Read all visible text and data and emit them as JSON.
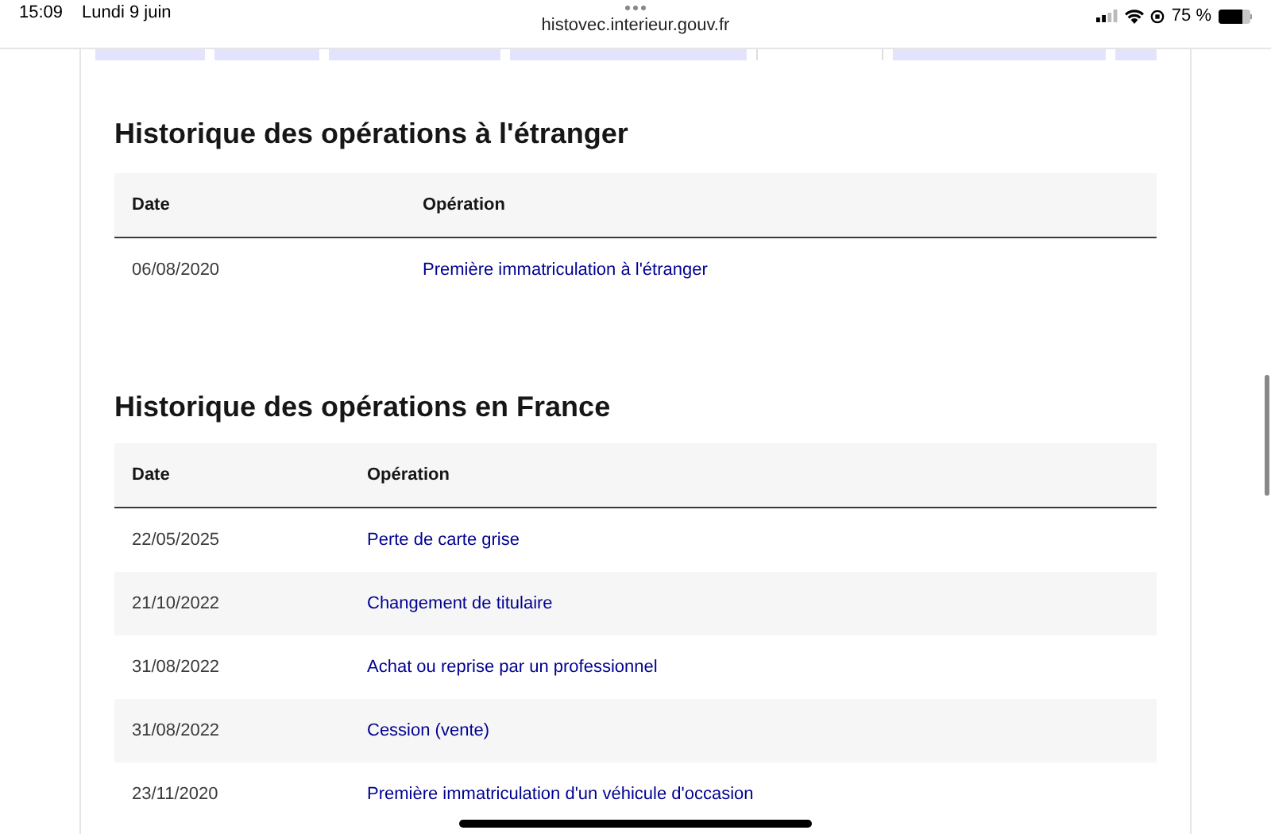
{
  "status_bar": {
    "time": "15:09",
    "date": "Lundi 9 juin",
    "url": "histovec.interieur.gouv.fr",
    "battery_text": "75 %",
    "battery": {
      "level": 0.75
    }
  },
  "tabs": [
    {
      "selected": false
    },
    {
      "selected": false
    },
    {
      "selected": false
    },
    {
      "selected": false
    },
    {
      "selected": true
    },
    {
      "selected": false
    },
    {
      "selected": false
    }
  ],
  "sections": [
    {
      "title": "Historique des opérations à l'étranger",
      "columns": [
        "Date",
        "Opération"
      ],
      "rows": [
        {
          "date": "06/08/2020",
          "operation": "Première immatriculation à l'étranger"
        }
      ]
    },
    {
      "title": "Historique des opérations en France",
      "columns": [
        "Date",
        "Opération"
      ],
      "rows": [
        {
          "date": "22/05/2025",
          "operation": "Perte de carte grise"
        },
        {
          "date": "21/10/2022",
          "operation": "Changement de titulaire"
        },
        {
          "date": "31/08/2022",
          "operation": "Achat ou reprise par un professionnel"
        },
        {
          "date": "31/08/2022",
          "operation": "Cession (vente)"
        },
        {
          "date": "23/11/2020",
          "operation": "Première immatriculation d'un véhicule d'occasion"
        }
      ]
    }
  ]
}
